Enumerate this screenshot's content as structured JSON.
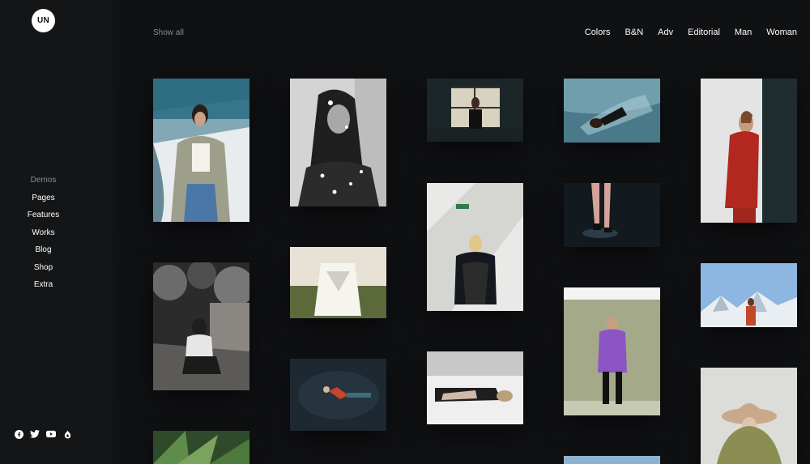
{
  "logo": {
    "text": "UN"
  },
  "sidebar": {
    "items": [
      {
        "label": "Demos"
      },
      {
        "label": "Pages"
      },
      {
        "label": "Features"
      },
      {
        "label": "Works"
      },
      {
        "label": "Blog"
      },
      {
        "label": "Shop"
      },
      {
        "label": "Extra"
      }
    ],
    "social": [
      "facebook-icon",
      "twitter-icon",
      "youtube-icon",
      "instagram-icon"
    ]
  },
  "toolbar": {
    "show_all": "Show all"
  },
  "filters": [
    {
      "label": "Colors"
    },
    {
      "label": "B&N"
    },
    {
      "label": "Adv"
    },
    {
      "label": "Editorial"
    },
    {
      "label": "Man"
    },
    {
      "label": "Woman"
    }
  ],
  "colors": {
    "background": "#101113",
    "sidebar": "#141517",
    "text": "#ffffff",
    "muted": "#8a8b8d"
  },
  "photos": [
    {
      "subject": "woman-plaid-shirt-blue-wall"
    },
    {
      "subject": "woman-flowers-black-white"
    },
    {
      "subject": "woman-window-dark"
    },
    {
      "subject": "woman-lying-ice"
    },
    {
      "subject": "woman-red-coat-wall"
    },
    {
      "subject": "woman-sitting-ruins-black-white"
    },
    {
      "subject": "figure-white-sheet-field"
    },
    {
      "subject": "woman-leaning-white-wall"
    },
    {
      "subject": "legs-heels-dark"
    },
    {
      "subject": "woman-snowy-mountain"
    },
    {
      "subject": "person-floating-water"
    },
    {
      "subject": "woman-lying-bed-black-white"
    },
    {
      "subject": "woman-purple-jacket-green-backdrop"
    },
    {
      "subject": "woman-beige-hat"
    },
    {
      "subject": "palm-leaves"
    },
    {
      "subject": "blue-sky-partial"
    }
  ]
}
